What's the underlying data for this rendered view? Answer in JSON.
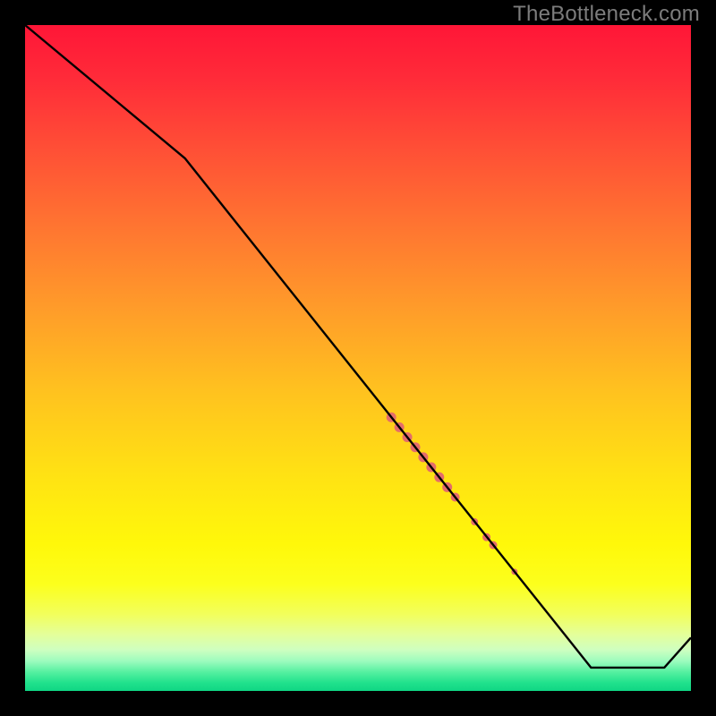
{
  "watermark": "TheBottleneck.com",
  "colors": {
    "frame": "#000000",
    "line": "#000000",
    "markers": "#e46d6a",
    "gradient_stops": [
      {
        "offset": 0.0,
        "color": "#ff1637"
      },
      {
        "offset": 0.08,
        "color": "#ff2b39"
      },
      {
        "offset": 0.18,
        "color": "#ff4d36"
      },
      {
        "offset": 0.3,
        "color": "#ff7431"
      },
      {
        "offset": 0.42,
        "color": "#ff9a2a"
      },
      {
        "offset": 0.55,
        "color": "#ffc21f"
      },
      {
        "offset": 0.68,
        "color": "#ffe313"
      },
      {
        "offset": 0.78,
        "color": "#fff80a"
      },
      {
        "offset": 0.84,
        "color": "#fcff1d"
      },
      {
        "offset": 0.885,
        "color": "#f2ff5c"
      },
      {
        "offset": 0.915,
        "color": "#e4ff9a"
      },
      {
        "offset": 0.938,
        "color": "#cfffc0"
      },
      {
        "offset": 0.955,
        "color": "#9dfcbe"
      },
      {
        "offset": 0.972,
        "color": "#54f0a0"
      },
      {
        "offset": 0.988,
        "color": "#20e18c"
      },
      {
        "offset": 1.0,
        "color": "#0fd684"
      }
    ]
  },
  "chart_data": {
    "type": "line",
    "title": "",
    "xlabel": "",
    "ylabel": "",
    "xlim": [
      0,
      100
    ],
    "ylim": [
      0,
      100
    ],
    "series": [
      {
        "name": "curve",
        "points": [
          {
            "x": 0,
            "y": 100
          },
          {
            "x": 24,
            "y": 80
          },
          {
            "x": 85,
            "y": 3.5
          },
          {
            "x": 96,
            "y": 3.5
          },
          {
            "x": 100,
            "y": 8
          }
        ]
      }
    ],
    "markers": {
      "name": "highlight-segment",
      "color": "#e46d6a",
      "points": [
        {
          "x": 55.0,
          "y": 41.1,
          "r": 5.5
        },
        {
          "x": 56.2,
          "y": 39.6,
          "r": 5.5
        },
        {
          "x": 57.4,
          "y": 38.1,
          "r": 5.5
        },
        {
          "x": 58.6,
          "y": 36.6,
          "r": 5.5
        },
        {
          "x": 59.8,
          "y": 35.1,
          "r": 5.5
        },
        {
          "x": 61.0,
          "y": 33.6,
          "r": 5.5
        },
        {
          "x": 62.2,
          "y": 32.1,
          "r": 5.5
        },
        {
          "x": 63.4,
          "y": 30.6,
          "r": 5.5
        },
        {
          "x": 64.6,
          "y": 29.1,
          "r": 5.0
        },
        {
          "x": 67.5,
          "y": 25.4,
          "r": 4.0
        },
        {
          "x": 69.3,
          "y": 23.1,
          "r": 4.5
        },
        {
          "x": 70.3,
          "y": 21.9,
          "r": 4.5
        },
        {
          "x": 73.5,
          "y": 17.9,
          "r": 3.5
        }
      ]
    }
  }
}
